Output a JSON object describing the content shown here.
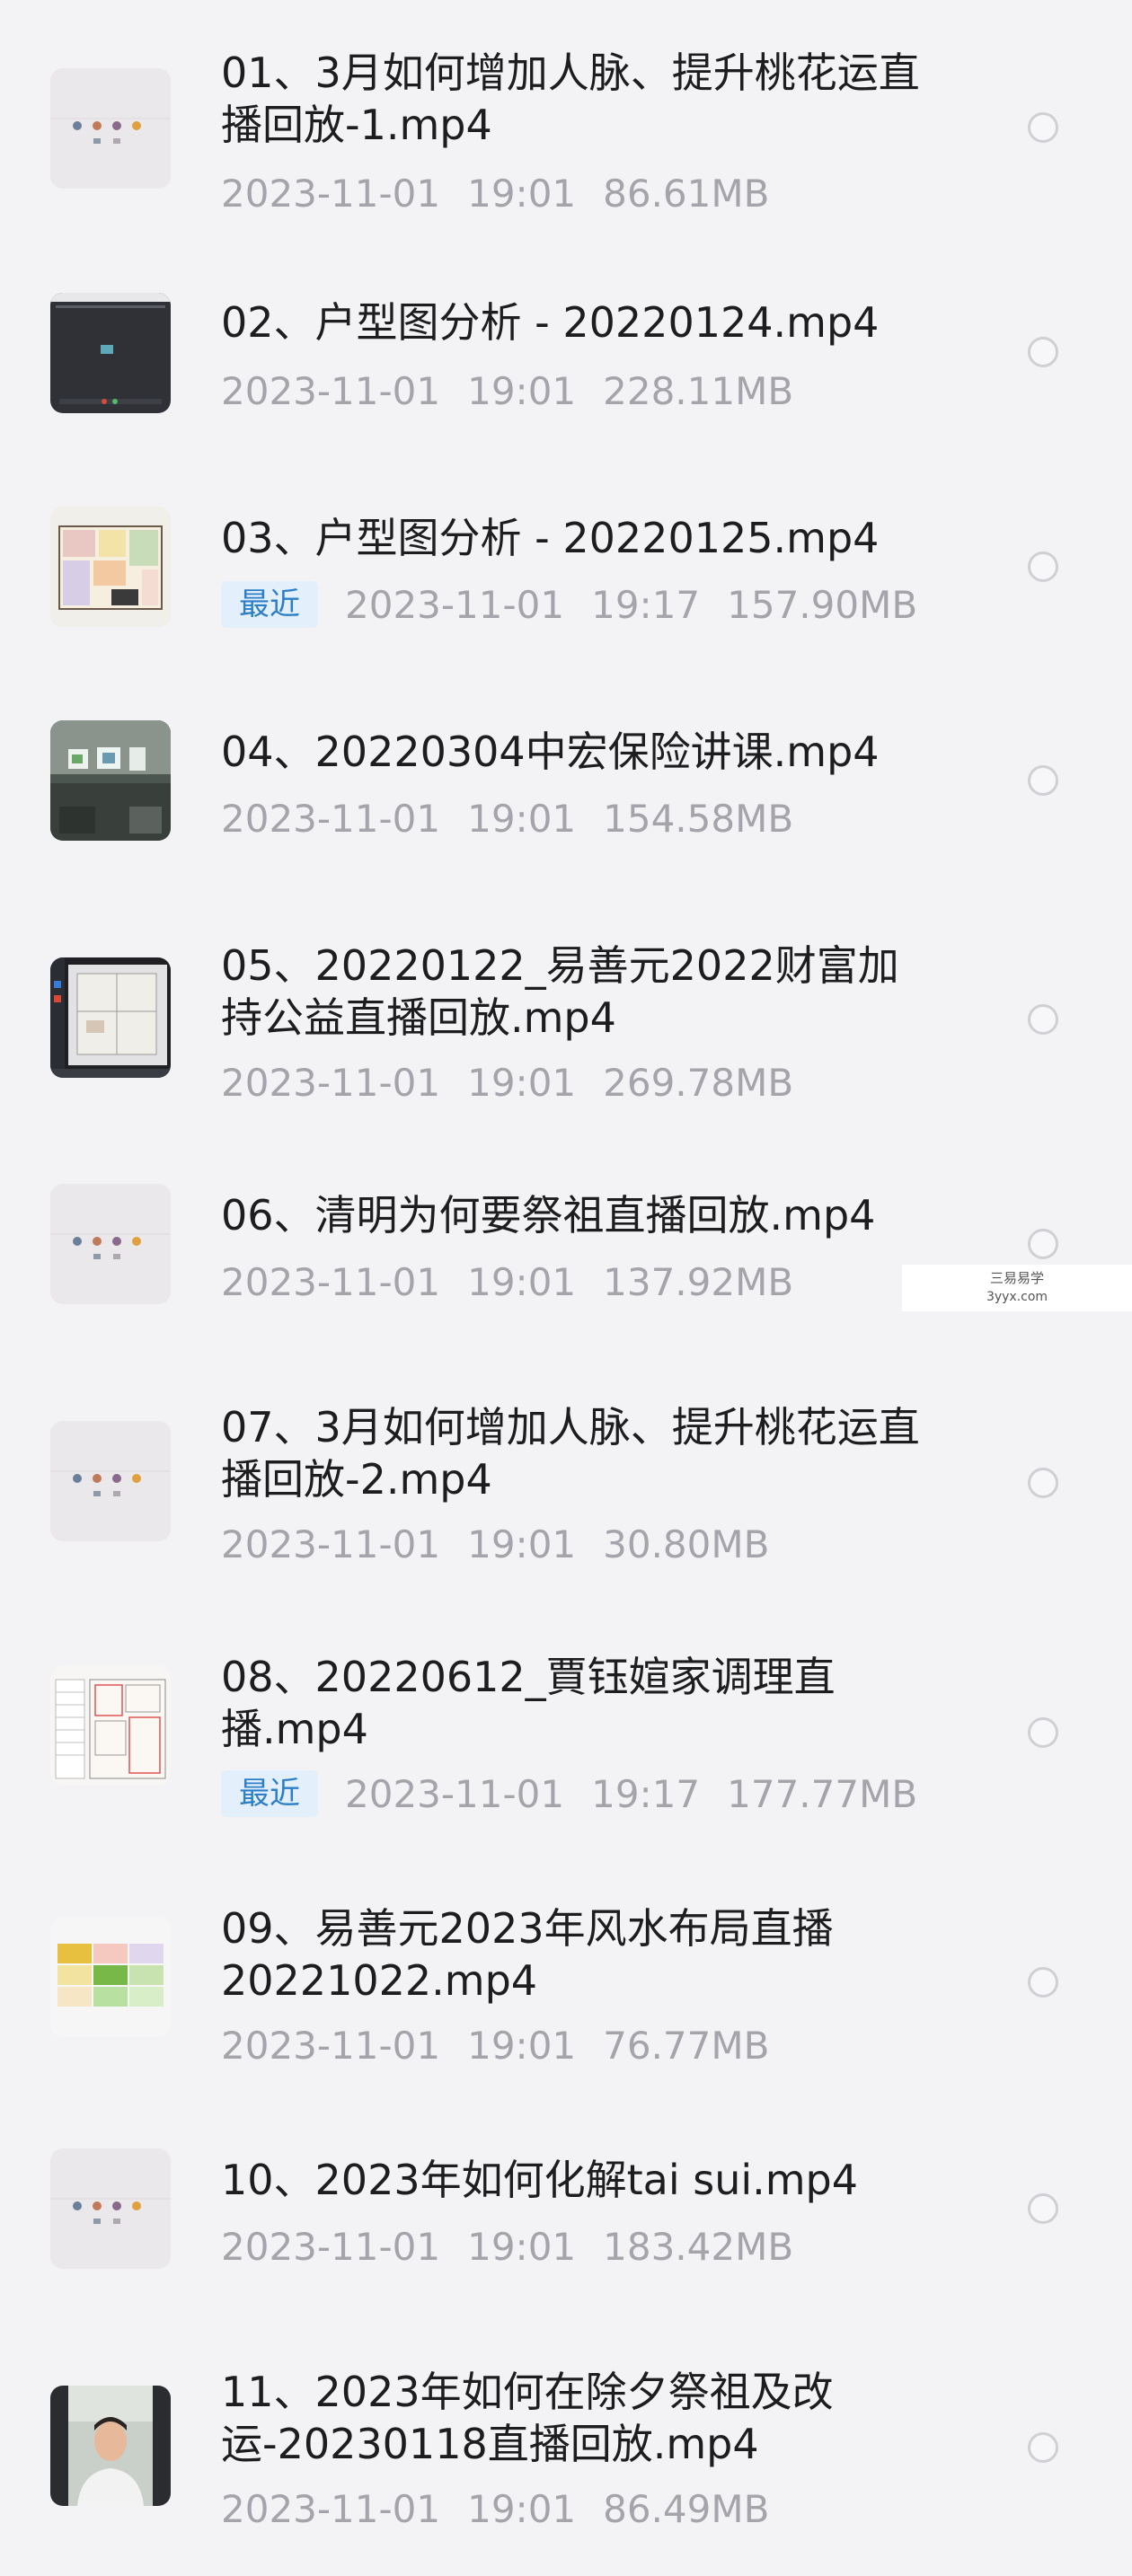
{
  "files": [
    {
      "title": "01、3月如何增加人脉、提升桃花运直\n播回放-1.mp4",
      "date": "2023-11-01",
      "time": "19:01",
      "size": "86.61MB",
      "recent": "",
      "thumb": "dots-icon"
    },
    {
      "title": "02、户型图分析 - 20220124.mp4",
      "date": "2023-11-01",
      "time": "19:01",
      "size": "228.11MB",
      "recent": "",
      "thumb": "screen-dark-icon"
    },
    {
      "title": "03、户型图分析 - 20220125.mp4",
      "date": "2023-11-01",
      "time": "19:17",
      "size": "157.90MB",
      "recent": "最近",
      "thumb": "floorplan-icon"
    },
    {
      "title": "04、20220304中宏保险讲课.mp4",
      "date": "2023-11-01",
      "time": "19:01",
      "size": "154.58MB",
      "recent": "",
      "thumb": "room-icon"
    },
    {
      "title": "05、20220122_易善元2022财富加\n持公益直播回放.mp4",
      "date": "2023-11-01",
      "time": "19:01",
      "size": "269.78MB",
      "recent": "",
      "thumb": "screenshare-icon"
    },
    {
      "title": "06、清明为何要祭祖直播回放.mp4",
      "date": "2023-11-01",
      "time": "19:01",
      "size": "137.92MB",
      "recent": "",
      "thumb": "dots-icon"
    },
    {
      "title": "07、3月如何增加人脉、提升桃花运直\n播回放-2.mp4",
      "date": "2023-11-01",
      "time": "19:01",
      "size": "30.80MB",
      "recent": "",
      "thumb": "dots-icon"
    },
    {
      "title": "08、20220612_賈钰媗家调理直\n播.mp4",
      "date": "2023-11-01",
      "time": "19:17",
      "size": "177.77MB",
      "recent": "最近",
      "thumb": "blueprint-icon"
    },
    {
      "title": "09、易善元2023年风水布局直播\n20221022.mp4",
      "date": "2023-11-01",
      "time": "19:01",
      "size": "76.77MB",
      "recent": "",
      "thumb": "grid-chart-icon"
    },
    {
      "title": "10、2023年如何化解tai sui.mp4",
      "date": "2023-11-01",
      "time": "19:01",
      "size": "183.42MB",
      "recent": "",
      "thumb": "dots-icon"
    },
    {
      "title": "11、2023年如何在除夕祭祖及改\n运-20230118直播回放.mp4",
      "date": "2023-11-01",
      "time": "19:01",
      "size": "86.49MB",
      "recent": "",
      "thumb": "person-video-icon"
    }
  ],
  "watermark": {
    "line1": "三易易学",
    "line2": "3yyx.com"
  }
}
